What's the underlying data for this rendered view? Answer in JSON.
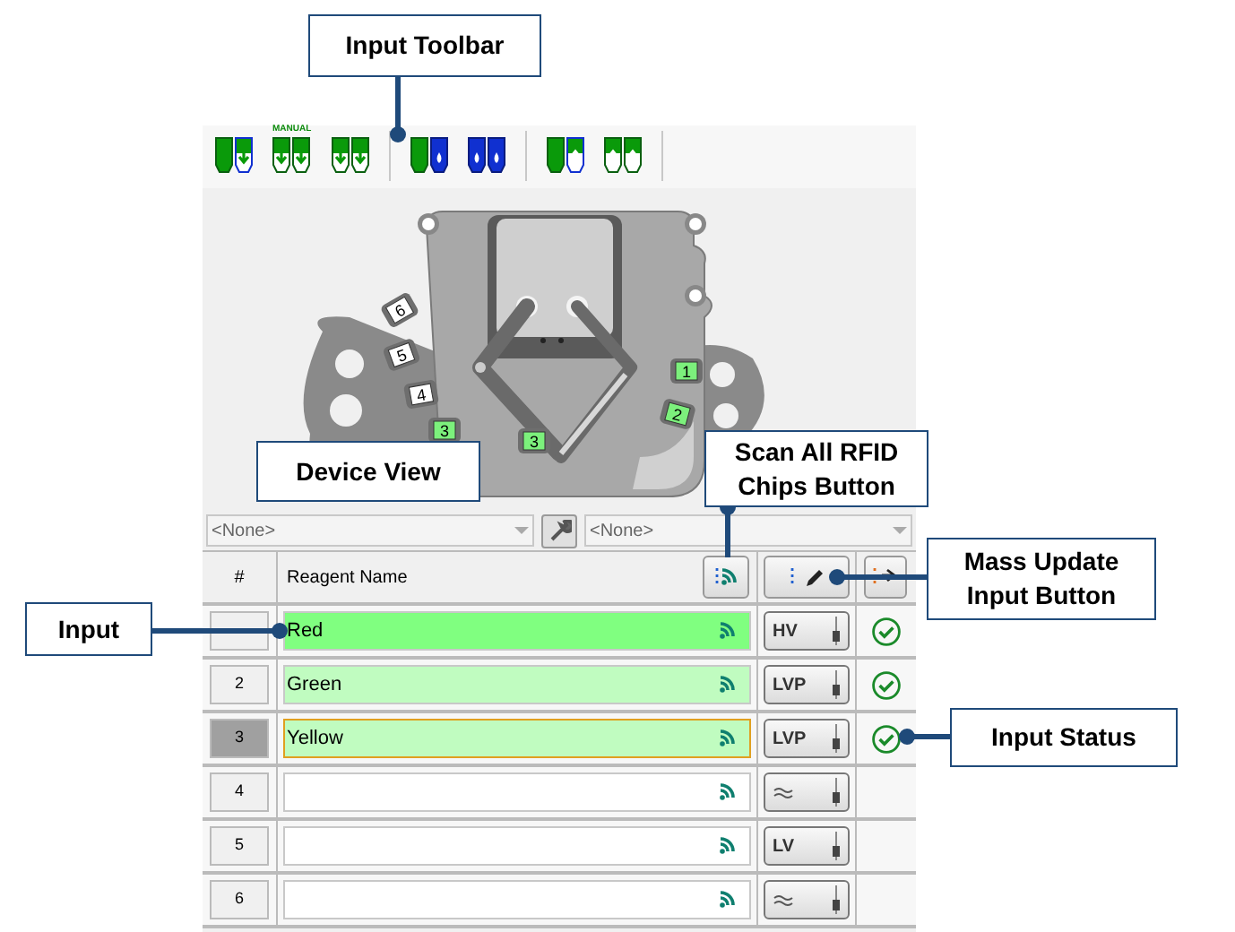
{
  "toolbar": {
    "manual_label": "MANUAL"
  },
  "device": {
    "left_slots": [
      "6",
      "5",
      "4",
      "3"
    ],
    "center_slot": "3",
    "right_slots": [
      "1",
      "2"
    ]
  },
  "selectors": [
    {
      "value": "<None>"
    },
    {
      "value": "<None>"
    }
  ],
  "table": {
    "columns": [
      "#",
      "Reagent Name"
    ],
    "rows": [
      {
        "name": "Red",
        "kind": "active",
        "selected": false,
        "valve": {
          "kind": "label",
          "label": "HV"
        },
        "ok": true
      },
      {
        "number": "2",
        "name": "Green",
        "kind": "assigned",
        "selected": false,
        "valve": {
          "kind": "label",
          "label": "LVP"
        },
        "ok": true
      },
      {
        "number": "3",
        "name": "Yellow",
        "kind": "assigned",
        "selected": true,
        "valve": {
          "kind": "label",
          "label": "LVP"
        },
        "ok": true
      },
      {
        "number": "4",
        "kind": "empty",
        "selected": false,
        "valve": {
          "kind": "wave"
        },
        "ok": false
      },
      {
        "number": "5",
        "kind": "empty",
        "selected": false,
        "valve": {
          "kind": "label",
          "label": "LV"
        },
        "ok": false
      },
      {
        "number": "6",
        "kind": "empty",
        "selected": false,
        "valve": {
          "kind": "wave"
        },
        "ok": false
      }
    ]
  },
  "callouts": [
    {
      "text": "Input Toolbar",
      "kind": "toolbar"
    },
    {
      "text": "Device View",
      "kind": "device"
    },
    {
      "text": "Scan All RFID Chips Button",
      "kind": "scan"
    },
    {
      "text": "Mass Update Input Button",
      "kind": "mass"
    },
    {
      "text": "Input",
      "kind": "input"
    },
    {
      "text": "Input Status",
      "kind": "status"
    }
  ]
}
